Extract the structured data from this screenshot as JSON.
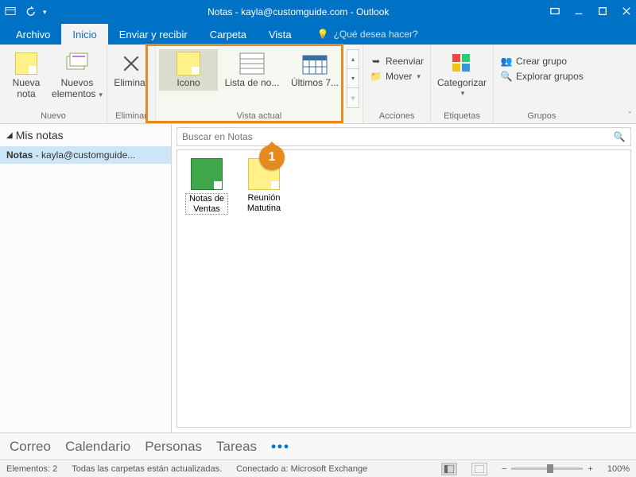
{
  "title": "Notas - kayla@customguide.com - Outlook",
  "tabs": {
    "archivo": "Archivo",
    "inicio": "Inicio",
    "enviar": "Enviar y recibir",
    "carpeta": "Carpeta",
    "vista": "Vista",
    "tellme": "¿Qué desea hacer?"
  },
  "ribbon": {
    "nuevo": {
      "label": "Nuevo",
      "nueva_nota1": "Nueva",
      "nueva_nota2": "nota",
      "nuevos1": "Nuevos",
      "nuevos2": "elementos"
    },
    "eliminar": {
      "label": "Eliminar",
      "btn": "Eliminar"
    },
    "vista": {
      "label": "Vista actual",
      "icono": "Icono",
      "lista": "Lista de no...",
      "ultimos": "Últimos 7..."
    },
    "acciones": {
      "label": "Acciones",
      "reenviar": "Reenviar",
      "mover": "Mover"
    },
    "etiquetas": {
      "label": "Etiquetas",
      "cat": "Categorizar"
    },
    "grupos": {
      "label": "Grupos",
      "crear": "Crear grupo",
      "explorar": "Explorar grupos"
    }
  },
  "nav": {
    "header": "Mis notas",
    "item": "Notas",
    "account": " - kayla@customguide..."
  },
  "search": {
    "placeholder": "Buscar en Notas"
  },
  "notes": [
    {
      "line1": "Notas de",
      "line2": "Ventas",
      "color": "green"
    },
    {
      "line1": "Reunión",
      "line2": "Matutina",
      "color": "yellow"
    }
  ],
  "bottomnav": {
    "correo": "Correo",
    "cal": "Calendario",
    "personas": "Personas",
    "tareas": "Tareas"
  },
  "status": {
    "items": "Elementos: 2",
    "sync": "Todas las carpetas están actualizadas.",
    "conn": "Conectado a: Microsoft Exchange",
    "zoom": "100%"
  },
  "callout": "1"
}
